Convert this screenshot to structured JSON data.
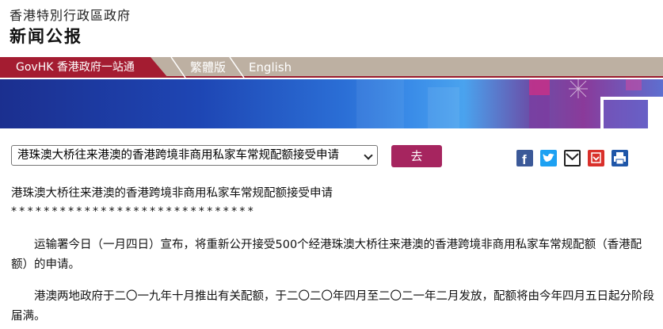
{
  "header": {
    "gov_name": "香港特別行政區政府",
    "site_title": "新闻公报"
  },
  "nav": {
    "govhk": "GovHK 香港政府一站通",
    "traditional": "繁體版",
    "english": "English"
  },
  "toolbar": {
    "select_value": "港珠澳大桥往来港澳的香港跨境非商用私家车常规配额接受申请",
    "go_label": "去"
  },
  "share": {
    "icons": [
      "facebook-icon",
      "twitter-icon",
      "email-icon",
      "bookmark-icon",
      "print-icon"
    ]
  },
  "article": {
    "title": "港珠澳大桥往来港澳的香港跨境非商用私家车常规配额接受申请",
    "stars": "******************************",
    "paragraph1": "　　运输署今日（一月四日）宣布，将重新公开接受500个经港珠澳大桥往来港澳的香港跨境非商用私家车常规配额（香港配额）的申请。",
    "paragraph2": "　　港澳两地政府于二〇一九年十月推出有关配额，于二〇二〇年四月至二〇二一年二月发放，配额将由今年四月五日起分阶段届满。"
  },
  "colors": {
    "brand_red": "#a41c31",
    "nav_bg": "#bdb0a2",
    "go_button": "#a6255f",
    "facebook": "#3b5998",
    "twitter": "#1da1f2",
    "bookmark": "#d9302b",
    "print": "#1f56a8"
  }
}
